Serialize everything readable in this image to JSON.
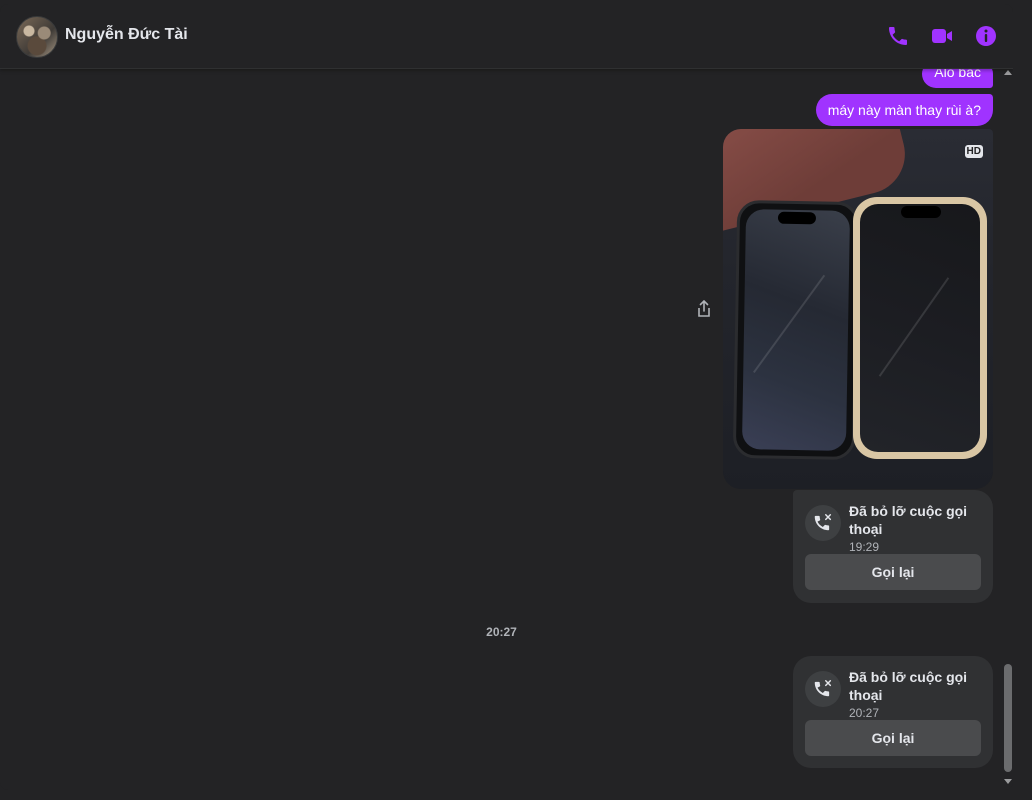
{
  "header": {
    "contact_name": "Nguyễn Đức Tài",
    "icons": [
      "phone-call-icon",
      "video-call-icon",
      "info-icon"
    ],
    "accent_color": "#a033ff"
  },
  "messages": {
    "bubble1": "Alo bác",
    "bubble2": "máy này màn thay rùi à?",
    "photo_badge": "HD"
  },
  "missed_calls": [
    {
      "title": "Đã bỏ lỡ cuộc gọi thoại",
      "time": "19:29",
      "button": "Gọi lại"
    },
    {
      "title": "Đã bỏ lỡ cuộc gọi thoại",
      "time": "20:27",
      "button": "Gọi lại"
    }
  ],
  "divider_time": "20:27",
  "colors": {
    "background": "#232325",
    "bubble": "#a033ff",
    "card": "#303133",
    "button": "#4a4b4d"
  }
}
